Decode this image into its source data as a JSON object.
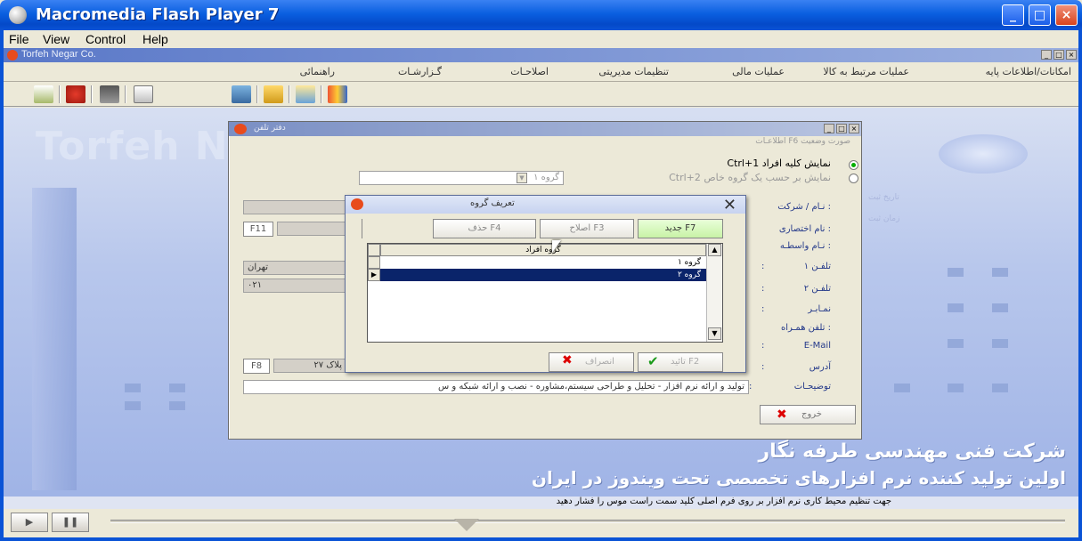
{
  "window": {
    "title": "Macromedia Flash Player 7",
    "min": "_",
    "max": "□",
    "close": "×"
  },
  "menu": {
    "file": "File",
    "view": "View",
    "control": "Control",
    "help": "Help"
  },
  "app": {
    "title": "Torfeh Negar Co.",
    "menu": [
      "امکانات/اطلاعات پایه",
      "عملیات مرتبط به کالا",
      "عملیات مالی",
      "تنظیمات مدیریتی",
      "اصلاحـات",
      "گـزارشـات",
      "راهنمائی"
    ]
  },
  "background": {
    "brand": "Torfeh N",
    "line1": "شرکت فنی مهندسی طرفه نگار",
    "line2": "اولین تولید کننده نرم افزارهای تخصصی تحت ویندوز در ایران"
  },
  "status": "جهت تنظیم محیط کاری نرم افزار بر روی فرم اصلی کلید سمت راست موس را فشار دهید",
  "phonebook": {
    "title": "دفتر تلفن",
    "tabs": "اطلاعـات   F6 صورت وضعیت",
    "opt1": "Ctrl+1  نمایش کلیه افراد",
    "opt2": "Ctrl+2 نمایش بر حسب یک گروه خاص",
    "group_select": "گروه ۱",
    "labels": [
      "نـام / شرکت :",
      "نام اختصاری :",
      "نـام واسطـه :",
      "تلفـن ۱",
      "تلفـن ۲",
      "نمـابـر",
      "تلفن همـراه :",
      "E-Mail",
      "آدرس",
      "توضیحـات"
    ],
    "f11": "F11",
    "city": "تهران",
    "code": "۰۲۱",
    "f8": "F8",
    "plak": "پلاک ۲۷",
    "description": "تولید و ارائه نرم افزار - تحلیل و طراحی سیستم،مشاوره - نصب و ارائه شبکه و س",
    "exit": "خروج",
    "side1": "تاریخ ثبت",
    "side2": "زمان ثبت"
  },
  "group_dialog": {
    "title": "تعریف گروه",
    "new": "جدید F7",
    "edit": "اصلاح F3",
    "delete": "حذف F4",
    "col": "گروه افراد",
    "rows": [
      "گروه ۱",
      "گروه ۲"
    ],
    "confirm": "تائید F2",
    "cancel": "انصراف"
  }
}
